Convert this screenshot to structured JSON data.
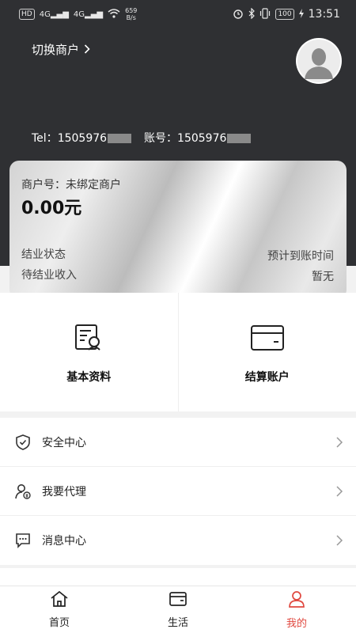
{
  "status_bar": {
    "sim_badge": "HD",
    "network_left": "4G",
    "network_right": "4G",
    "net_speed": "659",
    "net_speed_unit": "B/s",
    "battery": "100",
    "time": "13:51"
  },
  "header": {
    "switch_merchant": "切换商户",
    "tel_label": "Tel：",
    "tel_value": "1505976",
    "account_label": "账号：",
    "account_value": "1505976"
  },
  "card": {
    "merchant_no": "商户号：未绑定商户",
    "amount": "0.00元",
    "settle_status_label": "结业状态",
    "pending_income_label": "待结业收入",
    "eta_label": "预计到账时间",
    "eta_value": "暂无"
  },
  "shortcuts": [
    {
      "label": "基本资料",
      "icon": "profile-doc-icon"
    },
    {
      "label": "结算账户",
      "icon": "bank-card-icon"
    }
  ],
  "menu": [
    {
      "label": "安全中心",
      "icon": "shield-icon"
    },
    {
      "label": "我要代理",
      "icon": "agent-user-icon"
    },
    {
      "label": "消息中心",
      "icon": "message-icon"
    }
  ],
  "tabs": [
    {
      "label": "首页",
      "icon": "home-icon"
    },
    {
      "label": "生活",
      "icon": "wallet-icon"
    },
    {
      "label": "我的",
      "icon": "user-icon",
      "active": true
    }
  ],
  "colors": {
    "header_bg": "#2f3033",
    "accent": "#e0483f"
  }
}
